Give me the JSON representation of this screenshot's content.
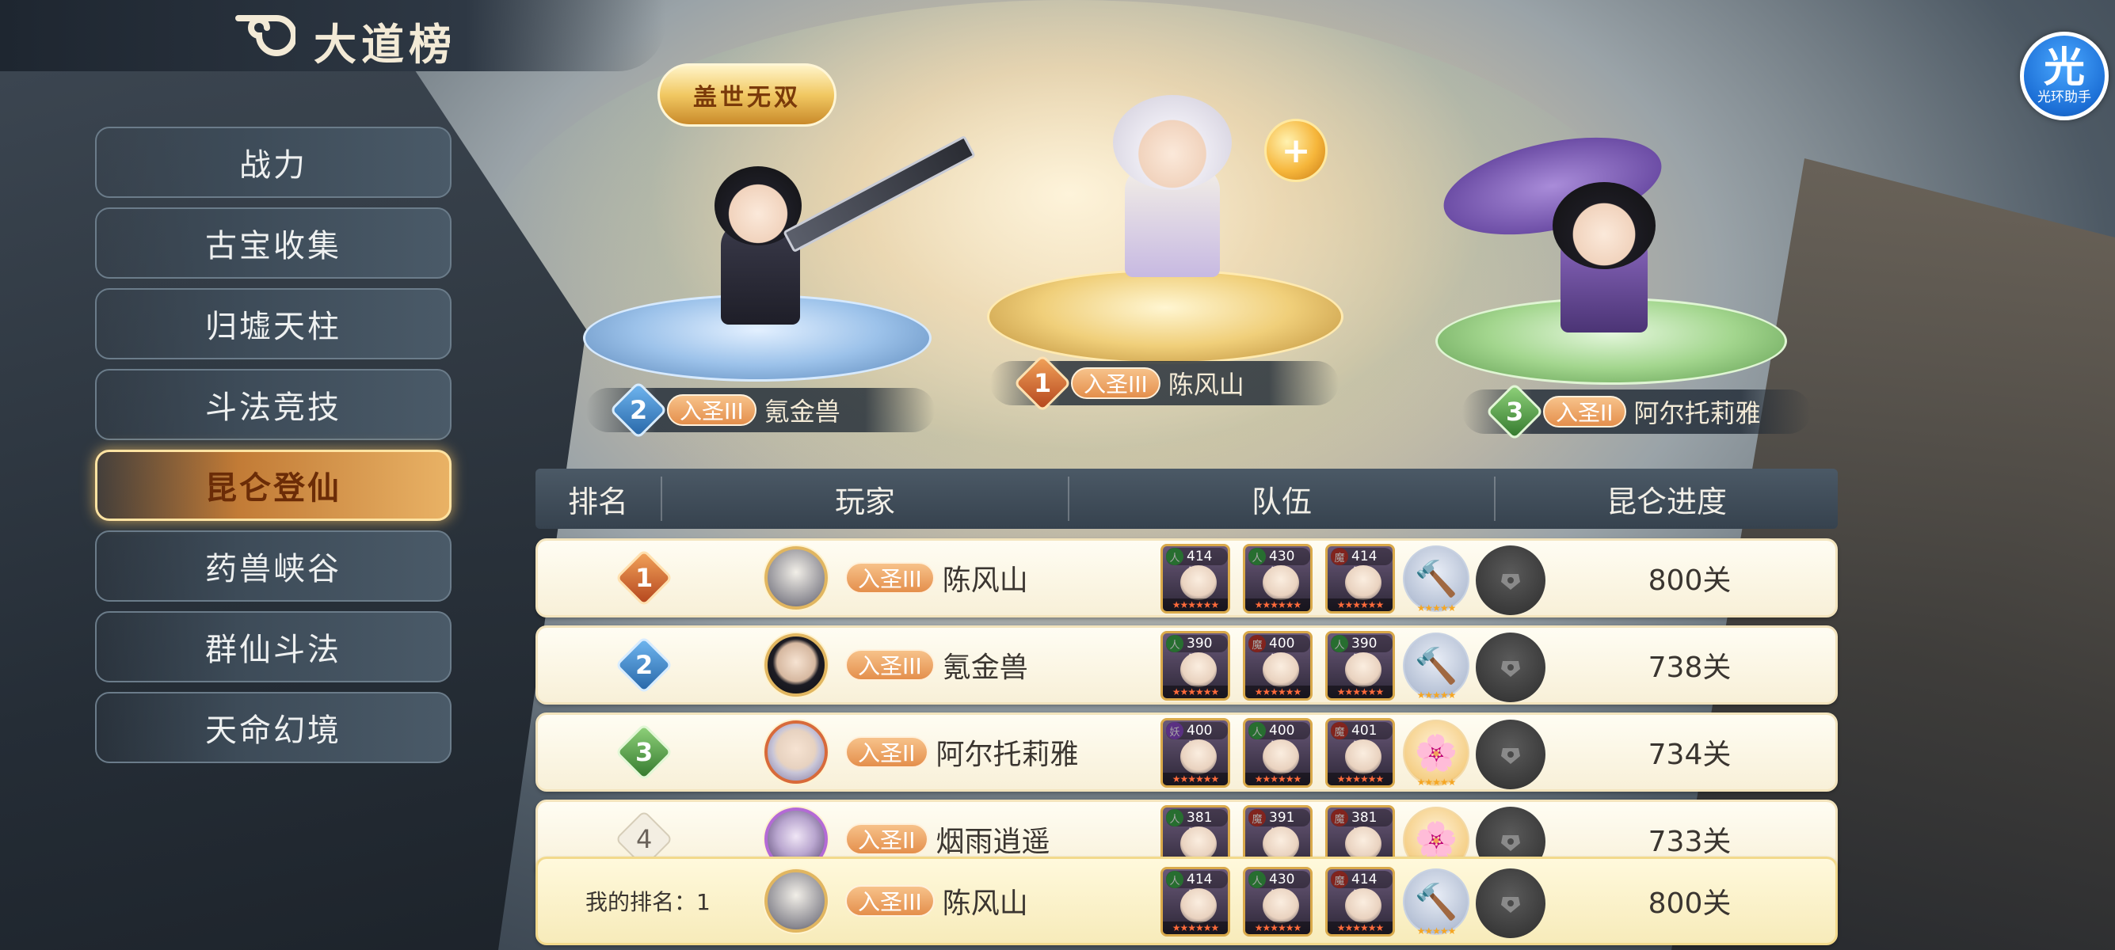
{
  "header": {
    "title": "大道榜"
  },
  "assistant": {
    "glyph": "光",
    "label": "光环助手"
  },
  "sidebar": {
    "items": [
      {
        "label": "战力",
        "active": false
      },
      {
        "label": "古宝收集",
        "active": false
      },
      {
        "label": "归墟天柱",
        "active": false
      },
      {
        "label": "斗法竞技",
        "active": false
      },
      {
        "label": "昆仑登仙",
        "active": true
      },
      {
        "label": "药兽峡谷",
        "active": false
      },
      {
        "label": "群仙斗法",
        "active": false
      },
      {
        "label": "天命幻境",
        "active": false
      }
    ]
  },
  "podium": {
    "crown_label": "盖世无双",
    "first": {
      "rank": "1",
      "title": "入圣III",
      "name": "陈风山"
    },
    "second": {
      "rank": "2",
      "title": "入圣III",
      "name": "氪金兽"
    },
    "third": {
      "rank": "3",
      "title": "入圣II",
      "name": "阿尔托莉雅"
    }
  },
  "table": {
    "headers": {
      "rank": "排名",
      "player": "玩家",
      "team": "队伍",
      "progress": "昆仑进度"
    },
    "rows": [
      {
        "rank": "1",
        "title": "入圣III",
        "name": "陈风山",
        "progress": "800关",
        "team": [
          {
            "level": "414级",
            "icon": "人"
          },
          {
            "level": "430级",
            "icon": "人"
          },
          {
            "level": "414级",
            "icon": "魔"
          }
        ]
      },
      {
        "rank": "2",
        "title": "入圣III",
        "name": "氪金兽",
        "progress": "738关",
        "team": [
          {
            "level": "390级",
            "icon": "人"
          },
          {
            "level": "400级",
            "icon": "魔"
          },
          {
            "level": "390级",
            "icon": "人"
          }
        ]
      },
      {
        "rank": "3",
        "title": "入圣II",
        "name": "阿尔托莉雅",
        "progress": "734关",
        "team": [
          {
            "level": "400级",
            "icon": "妖"
          },
          {
            "level": "400级",
            "icon": "人"
          },
          {
            "level": "401级",
            "icon": "魔"
          }
        ]
      },
      {
        "rank": "4",
        "title": "入圣II",
        "name": "烟雨逍遥",
        "progress": "733关",
        "team": [
          {
            "level": "381级",
            "icon": "人"
          },
          {
            "level": "391级",
            "icon": "魔"
          },
          {
            "level": "381级",
            "icon": "魔"
          }
        ]
      }
    ],
    "mine": {
      "label": "我的排名：1",
      "title": "入圣III",
      "name": "陈风山",
      "progress": "800关",
      "team": [
        {
          "level": "414级",
          "icon": "人"
        },
        {
          "level": "430级",
          "icon": "人"
        },
        {
          "level": "414级",
          "icon": "魔"
        }
      ]
    }
  },
  "colors": {
    "accent_active": "#e9b265",
    "gold": "#f6b63b",
    "row_bg": "#fffdf3"
  }
}
